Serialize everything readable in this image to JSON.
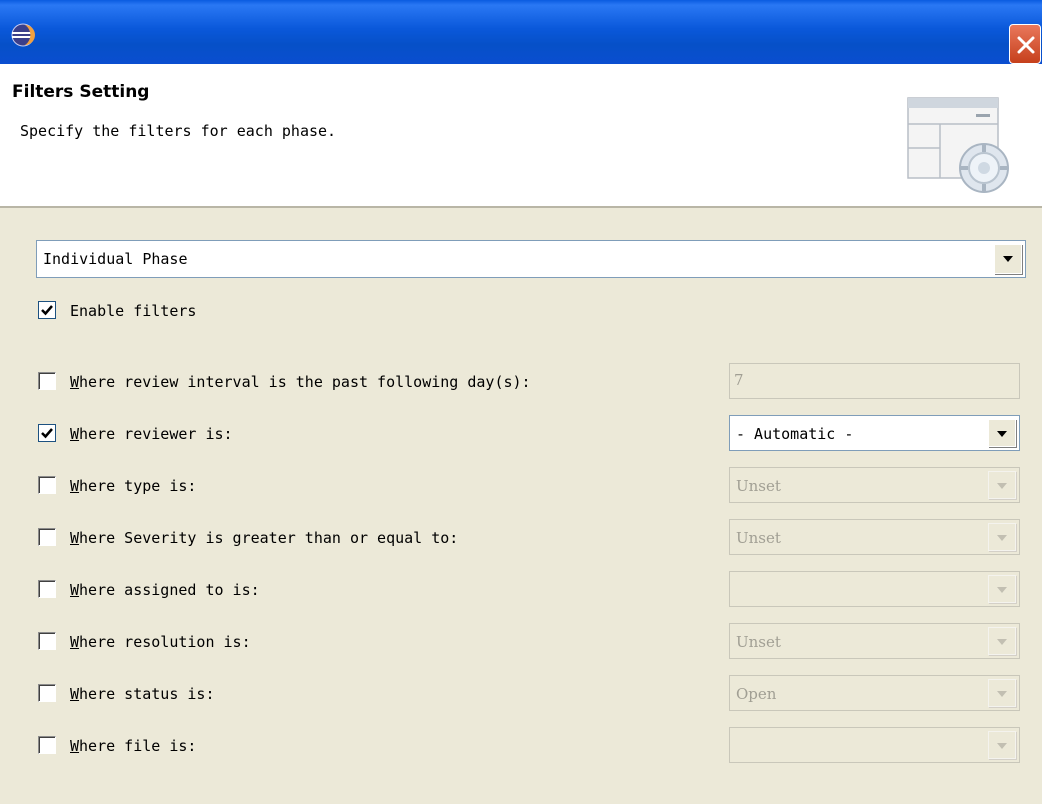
{
  "header": {
    "title": "Filters Setting",
    "description": "Specify the filters for each phase."
  },
  "phase_select": {
    "value": "Individual Phase"
  },
  "enable_filters": {
    "label": "Enable filters",
    "checked": true
  },
  "filters": [
    {
      "id": "review-interval",
      "mnemonic": "W",
      "label": "here review interval is the past following day(s):",
      "checked": false,
      "control": "text",
      "value": "7",
      "enabled": false
    },
    {
      "id": "reviewer",
      "mnemonic": "W",
      "label": "here reviewer is:",
      "checked": true,
      "control": "combo",
      "value": "- Automatic -",
      "enabled": true
    },
    {
      "id": "type",
      "mnemonic": "W",
      "label": "here type is:",
      "checked": false,
      "control": "combo",
      "value": "Unset",
      "enabled": false
    },
    {
      "id": "severity",
      "mnemonic": "W",
      "label": "here Severity is greater than or equal to:",
      "checked": false,
      "control": "combo",
      "value": "Unset",
      "enabled": false
    },
    {
      "id": "assigned-to",
      "mnemonic": "W",
      "label": "here assigned to is:",
      "checked": false,
      "control": "combo",
      "value": "",
      "enabled": false
    },
    {
      "id": "resolution",
      "mnemonic": "W",
      "label": "here resolution is:",
      "checked": false,
      "control": "combo",
      "value": "Unset",
      "enabled": false
    },
    {
      "id": "status",
      "mnemonic": "W",
      "label": "here status is:",
      "checked": false,
      "control": "combo",
      "value": "Open",
      "enabled": false
    },
    {
      "id": "file",
      "mnemonic": "W",
      "label": "here file is:",
      "checked": false,
      "control": "combo",
      "value": "",
      "enabled": false
    }
  ],
  "icons": {
    "app": "eclipse-icon",
    "close": "close-icon",
    "header": "filter-settings-graphic"
  },
  "colors": {
    "titlebar": "#0a58da",
    "close": "#d8552e",
    "dialog": "#ece9d8"
  }
}
